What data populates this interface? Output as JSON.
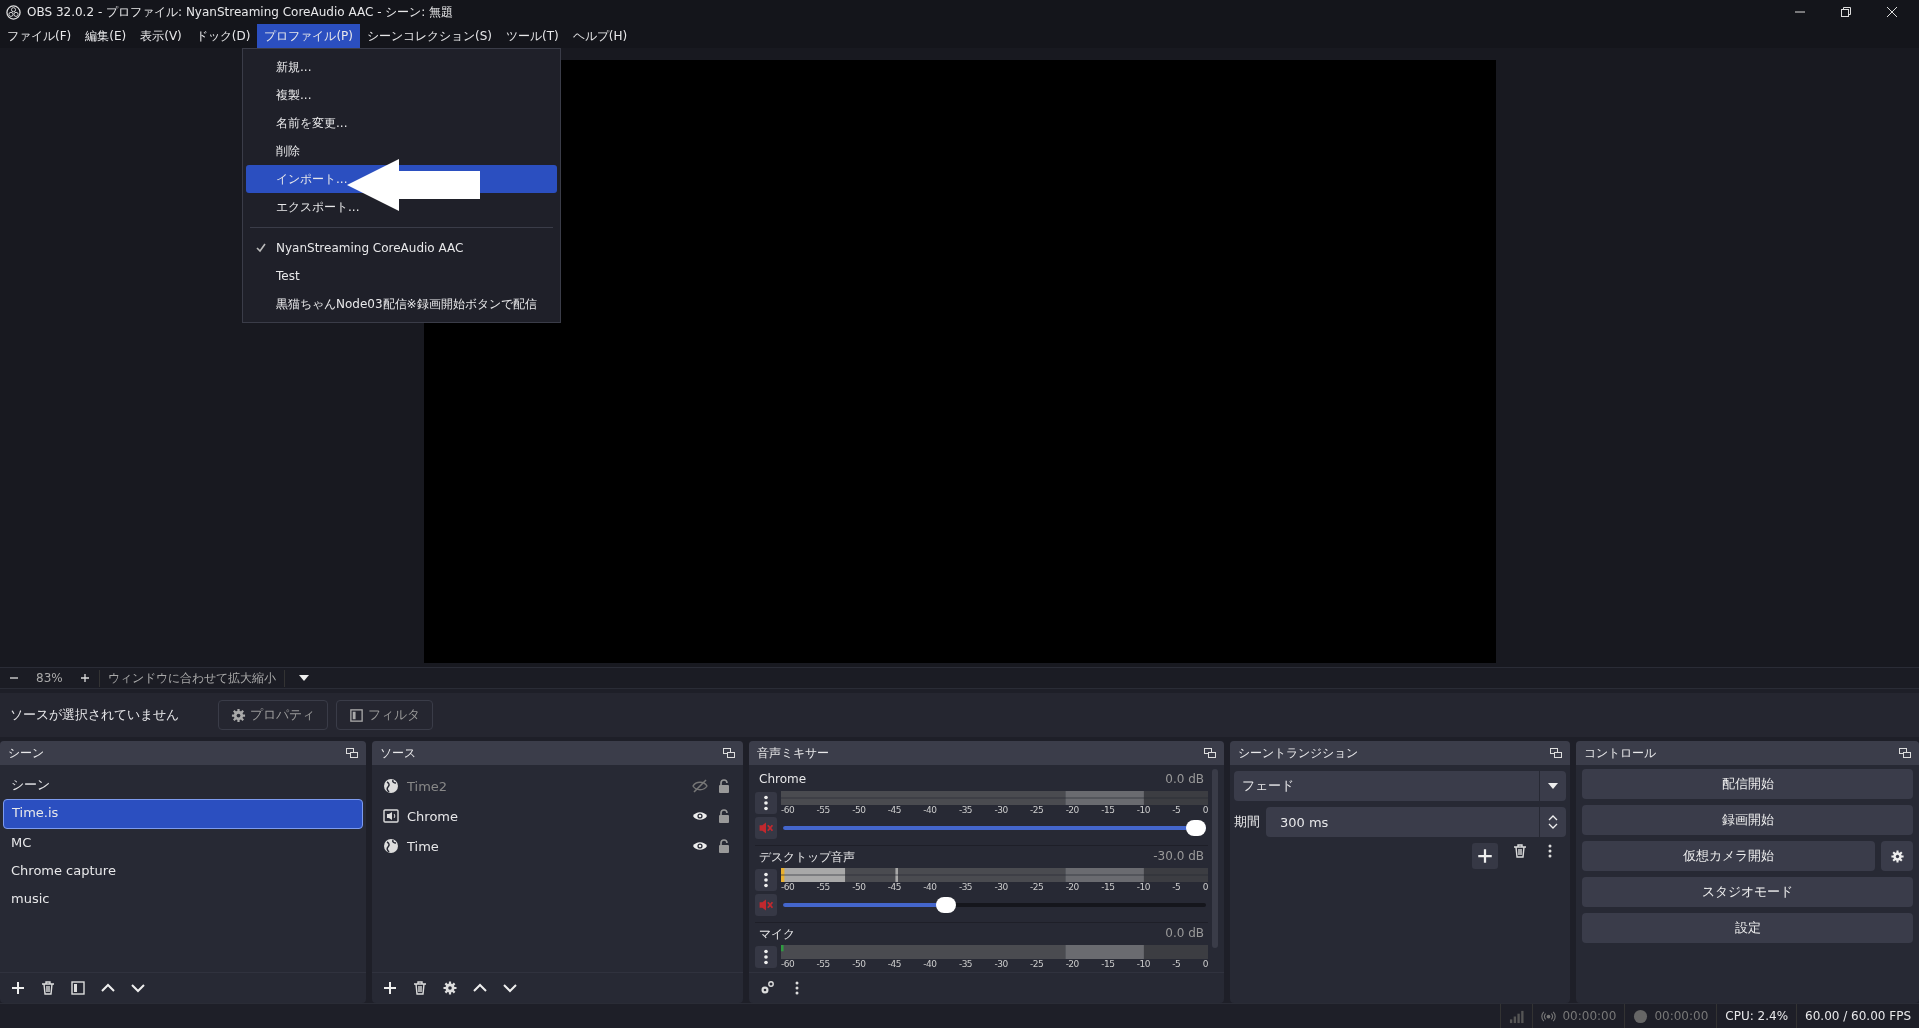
{
  "window": {
    "title": "OBS 32.0.2 - プロファイル: NyanStreaming CoreAudio AAC - シーン: 無題"
  },
  "menubar": [
    {
      "label": "ファイル(F)",
      "selected": false
    },
    {
      "label": "編集(E)",
      "selected": false
    },
    {
      "label": "表示(V)",
      "selected": false
    },
    {
      "label": "ドック(D)",
      "selected": false
    },
    {
      "label": "プロファイル(P)",
      "selected": true
    },
    {
      "label": "シーンコレクション(S)",
      "selected": false
    },
    {
      "label": "ツール(T)",
      "selected": false
    },
    {
      "label": "ヘルプ(H)",
      "selected": false
    }
  ],
  "profile_menu": {
    "actions": [
      {
        "label": "新規...",
        "selected": false
      },
      {
        "label": "複製...",
        "selected": false
      },
      {
        "label": "名前を変更...",
        "selected": false
      },
      {
        "label": "削除",
        "selected": false
      },
      {
        "label": "インポート...",
        "selected": true
      },
      {
        "label": "エクスポート...",
        "selected": false
      }
    ],
    "profiles": [
      {
        "label": "NyanStreaming CoreAudio AAC",
        "checked": true
      },
      {
        "label": "Test",
        "checked": false
      },
      {
        "label": "黒猫ちゃんNode03配信※録画開始ボタンで配信",
        "checked": false
      }
    ]
  },
  "preview_bar": {
    "zoom": "83%",
    "fit_label": "ウィンドウに合わせて拡大縮小"
  },
  "context_bar": {
    "status": "ソースが選択されていません",
    "buttons": [
      "プロパティ",
      "フィルタ"
    ]
  },
  "scenes": {
    "title": "シーン",
    "items": [
      {
        "label": "シーン",
        "selected": false
      },
      {
        "label": "Time.is",
        "selected": true
      },
      {
        "label": "MC",
        "selected": false
      },
      {
        "label": "Chrome capture",
        "selected": false
      },
      {
        "label": "music",
        "selected": false
      }
    ]
  },
  "sources": {
    "title": "ソース",
    "items": [
      {
        "label": "Time2",
        "kind": "browser",
        "visible": false
      },
      {
        "label": "Chrome",
        "kind": "app_audio",
        "visible": true
      },
      {
        "label": "Time",
        "kind": "browser",
        "visible": true
      }
    ]
  },
  "mixer": {
    "title": "音声ミキサー",
    "channels": [
      {
        "name": "Chrome",
        "reading": "0.0 dB",
        "muted": true,
        "level": 1.0,
        "scale": [
          "-60",
          "-55",
          "-50",
          "-45",
          "-40",
          "-35",
          "-30",
          "-25",
          "-20",
          "-15",
          "-10",
          "-5",
          "0"
        ]
      },
      {
        "name": "デスクトップ音声",
        "reading": "-30.0 dB",
        "muted": true,
        "level": 0.38,
        "scale": [
          "-60",
          "-55",
          "-50",
          "-45",
          "-40",
          "-35",
          "-30",
          "-25",
          "-20",
          "-15",
          "-10",
          "-5",
          "0"
        ]
      },
      {
        "name": "マイク",
        "reading": "0.0 dB",
        "scale": [
          "-60",
          "-55",
          "-50",
          "-45",
          "-40",
          "-35",
          "-30",
          "-25",
          "-20",
          "-15",
          "-10",
          "-5",
          "0"
        ]
      }
    ]
  },
  "transitions": {
    "title": "シーントランジション",
    "selected_transition": "フェード",
    "duration_label": "期間",
    "duration": "300 ms"
  },
  "controls": {
    "title": "コントロール",
    "buttons": [
      "配信開始",
      "録画開始",
      "仮想カメラ開始",
      "スタジオモード",
      "設定"
    ]
  },
  "status_bar": {
    "stream_time": "00:00:00",
    "record_time": "00:00:00",
    "cpu": "CPU: 2.4%",
    "fps": "60.00 / 60.00 FPS"
  }
}
